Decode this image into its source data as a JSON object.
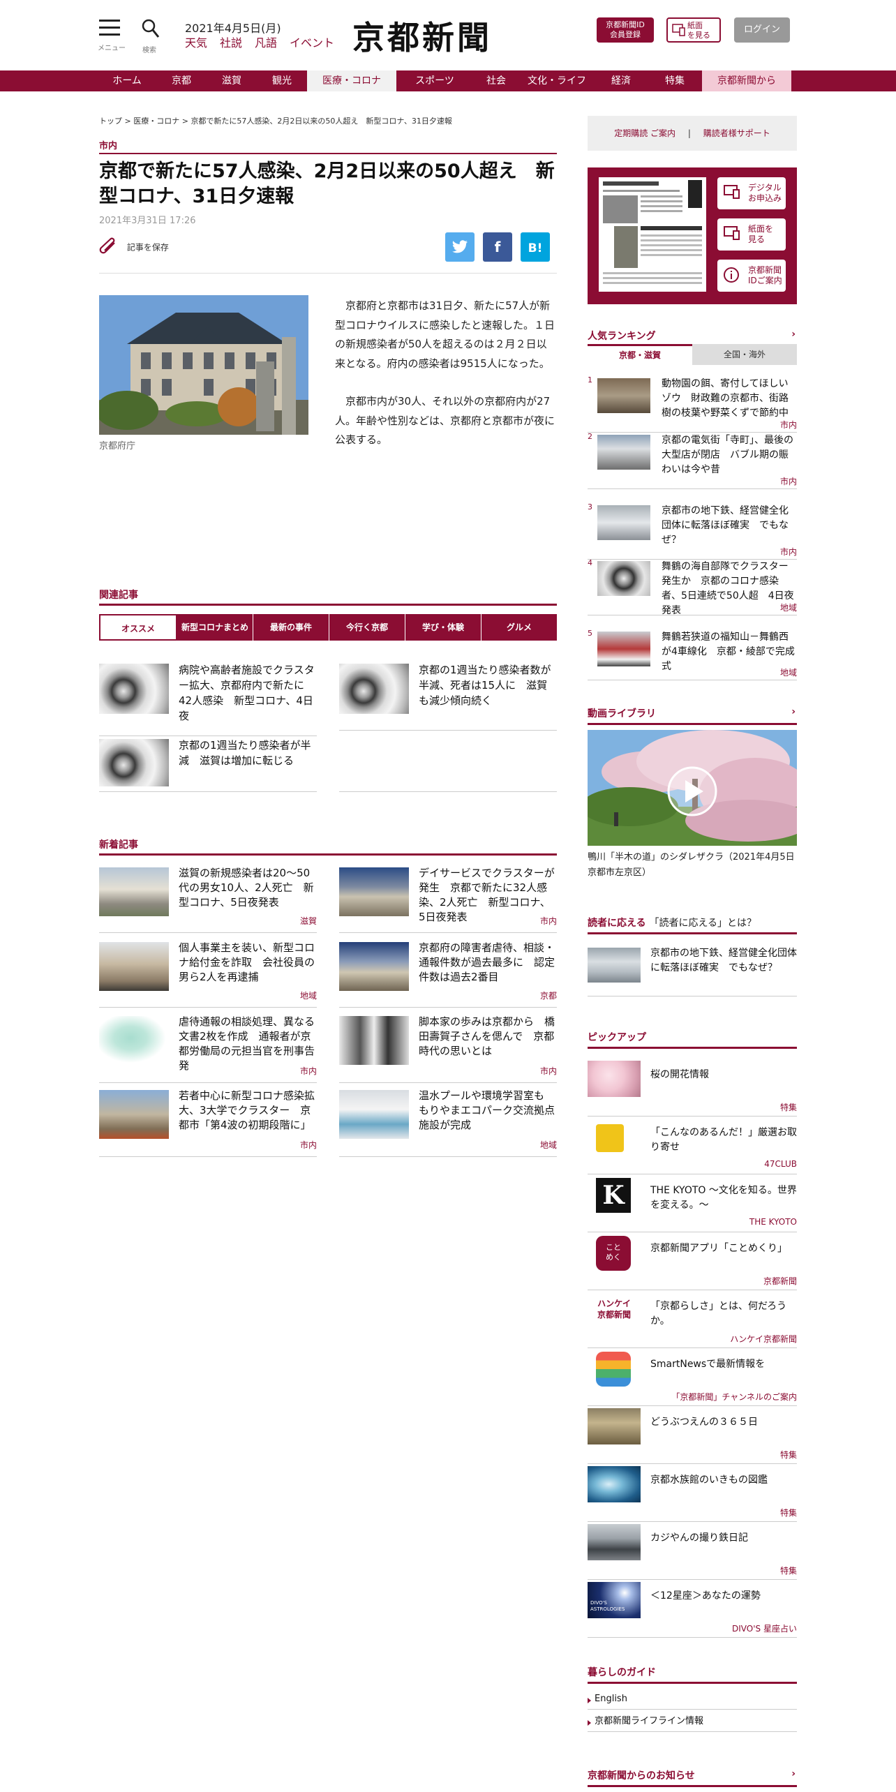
{
  "header": {
    "menu_caption": "メニュー",
    "search_caption": "検索",
    "date": "2021年4月5日(月)",
    "links": [
      "天気",
      "社説",
      "凡語",
      "イベント"
    ],
    "logo": "京都新聞",
    "id_button": "京都新聞ID\n会員登録",
    "paper_button": "紙面\nを見る",
    "login_button": "ログイン"
  },
  "nav": {
    "items": [
      "ホーム",
      "京都",
      "滋賀",
      "観光",
      "医療・コロナ",
      "スポーツ",
      "社会",
      "文化・ライフ",
      "経済",
      "特集",
      "京都新聞から"
    ],
    "active_index": 4
  },
  "article": {
    "breadcrumb": [
      "トップ",
      "医療・コロナ",
      "京都で新たに57人感染、2月2日以来の50人超え　新型コロナ、31日夕速報"
    ],
    "category": "市内",
    "title": "京都で新たに57人感染、2月2日以来の50人超え　新型コロナ、31日夕速報",
    "date": "2021年3月31日 17:26",
    "save_label": "記事を保存",
    "photo_caption": "京都府庁",
    "paragraphs": [
      "京都府と京都市は31日夕、新たに57人が新型コロナウイルスに感染したと速報した。１日の新規感染者が50人を超えるのは２月２日以来となる。府内の感染者は9515人になった。",
      "京都市内が30人、それ以外の京都府内が27人。年齢や性別などは、京都府と京都市が夜に公表する。"
    ]
  },
  "related": {
    "heading": "関連記事",
    "tabs": [
      "オススメ",
      "新型コロナまとめ",
      "最新の事件",
      "今行く京都",
      "学び・体験",
      "グルメ"
    ],
    "items": [
      {
        "title": "病院や高齢者施設でクラスター拡大、京都府内で新たに42人感染　新型コロナ、4日夜"
      },
      {
        "title": "京都の1週当たり感染者数が半減、死者は15人に　滋賀も減少傾向続く"
      },
      {
        "title": "京都の1週当たり感染者が半減　滋賀は増加に転じる"
      }
    ]
  },
  "latest": {
    "heading": "新着記事",
    "items": [
      {
        "title": "滋賀の新規感染者は20～50代の男女10人、2人死亡　新型コロナ、5日夜発表",
        "tag": "滋賀"
      },
      {
        "title": "デイサービスでクラスターが発生　京都で新たに32人感染、2人死亡　新型コロナ、5日夜発表",
        "tag": "市内"
      },
      {
        "title": "個人事業主を装い、新型コロナ給付金を詐取　会社役員の男ら2人を再逮捕",
        "tag": "地域"
      },
      {
        "title": "京都府の障害者虐待、相談・通報件数が過去最多に　認定件数は過去2番目",
        "tag": "京都"
      },
      {
        "title": "虐待通報の相談処理、異なる文書2枚を作成　通報者が京都労働局の元担当官を刑事告発",
        "tag": "市内"
      },
      {
        "title": "脚本家の歩みは京都から　橋田壽賀子さんを偲んで　京都時代の思いとは",
        "tag": "市内"
      },
      {
        "title": "若者中心に新型コロナ感染拡大、3大学でクラスター　京都市「第4波の初期段階に」",
        "tag": "市内"
      },
      {
        "title": "温水プールや環境学習室も　もりやまエコパーク交流拠点施設が完成",
        "tag": "地域"
      }
    ]
  },
  "sidebar": {
    "subscribe": "定期購読 ご案内",
    "support": "購読者様サポート",
    "paper_buttons": [
      "デジタル\nお申込み",
      "紙面を\n見る",
      "京都新聞\nIDご案内"
    ],
    "ranking_heading": "人気ランキング",
    "ranking_tabs": [
      "京都・滋賀",
      "全国・海外"
    ],
    "ranking": [
      {
        "num": "1",
        "title": "動物園の餌、寄付してほしいゾウ　財政難の京都市、街路樹の枝葉や野菜くずで節約中",
        "tag": "市内"
      },
      {
        "num": "2",
        "title": "京都の電気街「寺町」、最後の大型店が閉店　バブル期の賑わいは今や昔",
        "tag": "市内"
      },
      {
        "num": "3",
        "title": "京都市の地下鉄、経営健全化団体に転落ほぼ確実　でもなぜ？",
        "tag": "市内"
      },
      {
        "num": "4",
        "title": "舞鶴の海自部隊でクラスター発生か　京都のコロナ感染者、5日連続で50人超　4日夜発表",
        "tag": "地域"
      },
      {
        "num": "5",
        "title": "舞鶴若狭道の福知山－舞鶴西が4車線化　京都・綾部で完成式",
        "tag": "地域"
      }
    ],
    "video_heading": "動画ライブラリ",
    "video_caption": "鴨川「半木の道」のシダレザクラ（2021年4月5日　京都市左京区）",
    "answer_heading": "読者に応える",
    "answer_link": "「読者に応える」とは？",
    "answer_title": "京都市の地下鉄、経営健全化団体に転落ほぼ確実　でもなぜ？",
    "pickup_heading": "ピックアップ",
    "pickups": [
      {
        "title": "桜の開花情報",
        "tag": "特集"
      },
      {
        "title": "「こんなのあるんだ！」厳選お取り寄せ",
        "tag": "47CLUB"
      },
      {
        "title": "THE KYOTO ～文化を知る。世界を変える。～",
        "tag": "THE KYOTO"
      },
      {
        "title": "京都新聞アプリ「ことめくり」",
        "tag": "京都新聞"
      },
      {
        "title": "「京都らしさ」とは、何だろうか。",
        "tag": "ハンケイ京都新聞"
      },
      {
        "title": "SmartNewsで最新情報を",
        "tag": "「京都新聞」チャンネルのご案内"
      },
      {
        "title": "どうぶつえんの３６５日",
        "tag": "特集"
      },
      {
        "title": "京都水族館のいきもの図鑑",
        "tag": "特集"
      },
      {
        "title": "カジやんの撮り鉄日記",
        "tag": "特集"
      },
      {
        "title": "＜12星座＞あなたの運勢",
        "tag": "DIVO'S 星座占い"
      }
    ],
    "pickup_logo_text": {
      "kyoto": "K",
      "app": "こと\nめく",
      "hankei": "ハンケイ\n京都新聞",
      "divos": "DIVO'S\nASTROLOGIES"
    },
    "guide_heading": "暮らしのガイド",
    "guides": [
      "English",
      "京都新聞ライフライン情報"
    ],
    "notice_heading": "京都新聞からのお知らせ"
  },
  "colors": {
    "brand": "#8b0d33",
    "twitter": "#55acee",
    "facebook": "#3b5998",
    "hatena": "#00a4de"
  }
}
